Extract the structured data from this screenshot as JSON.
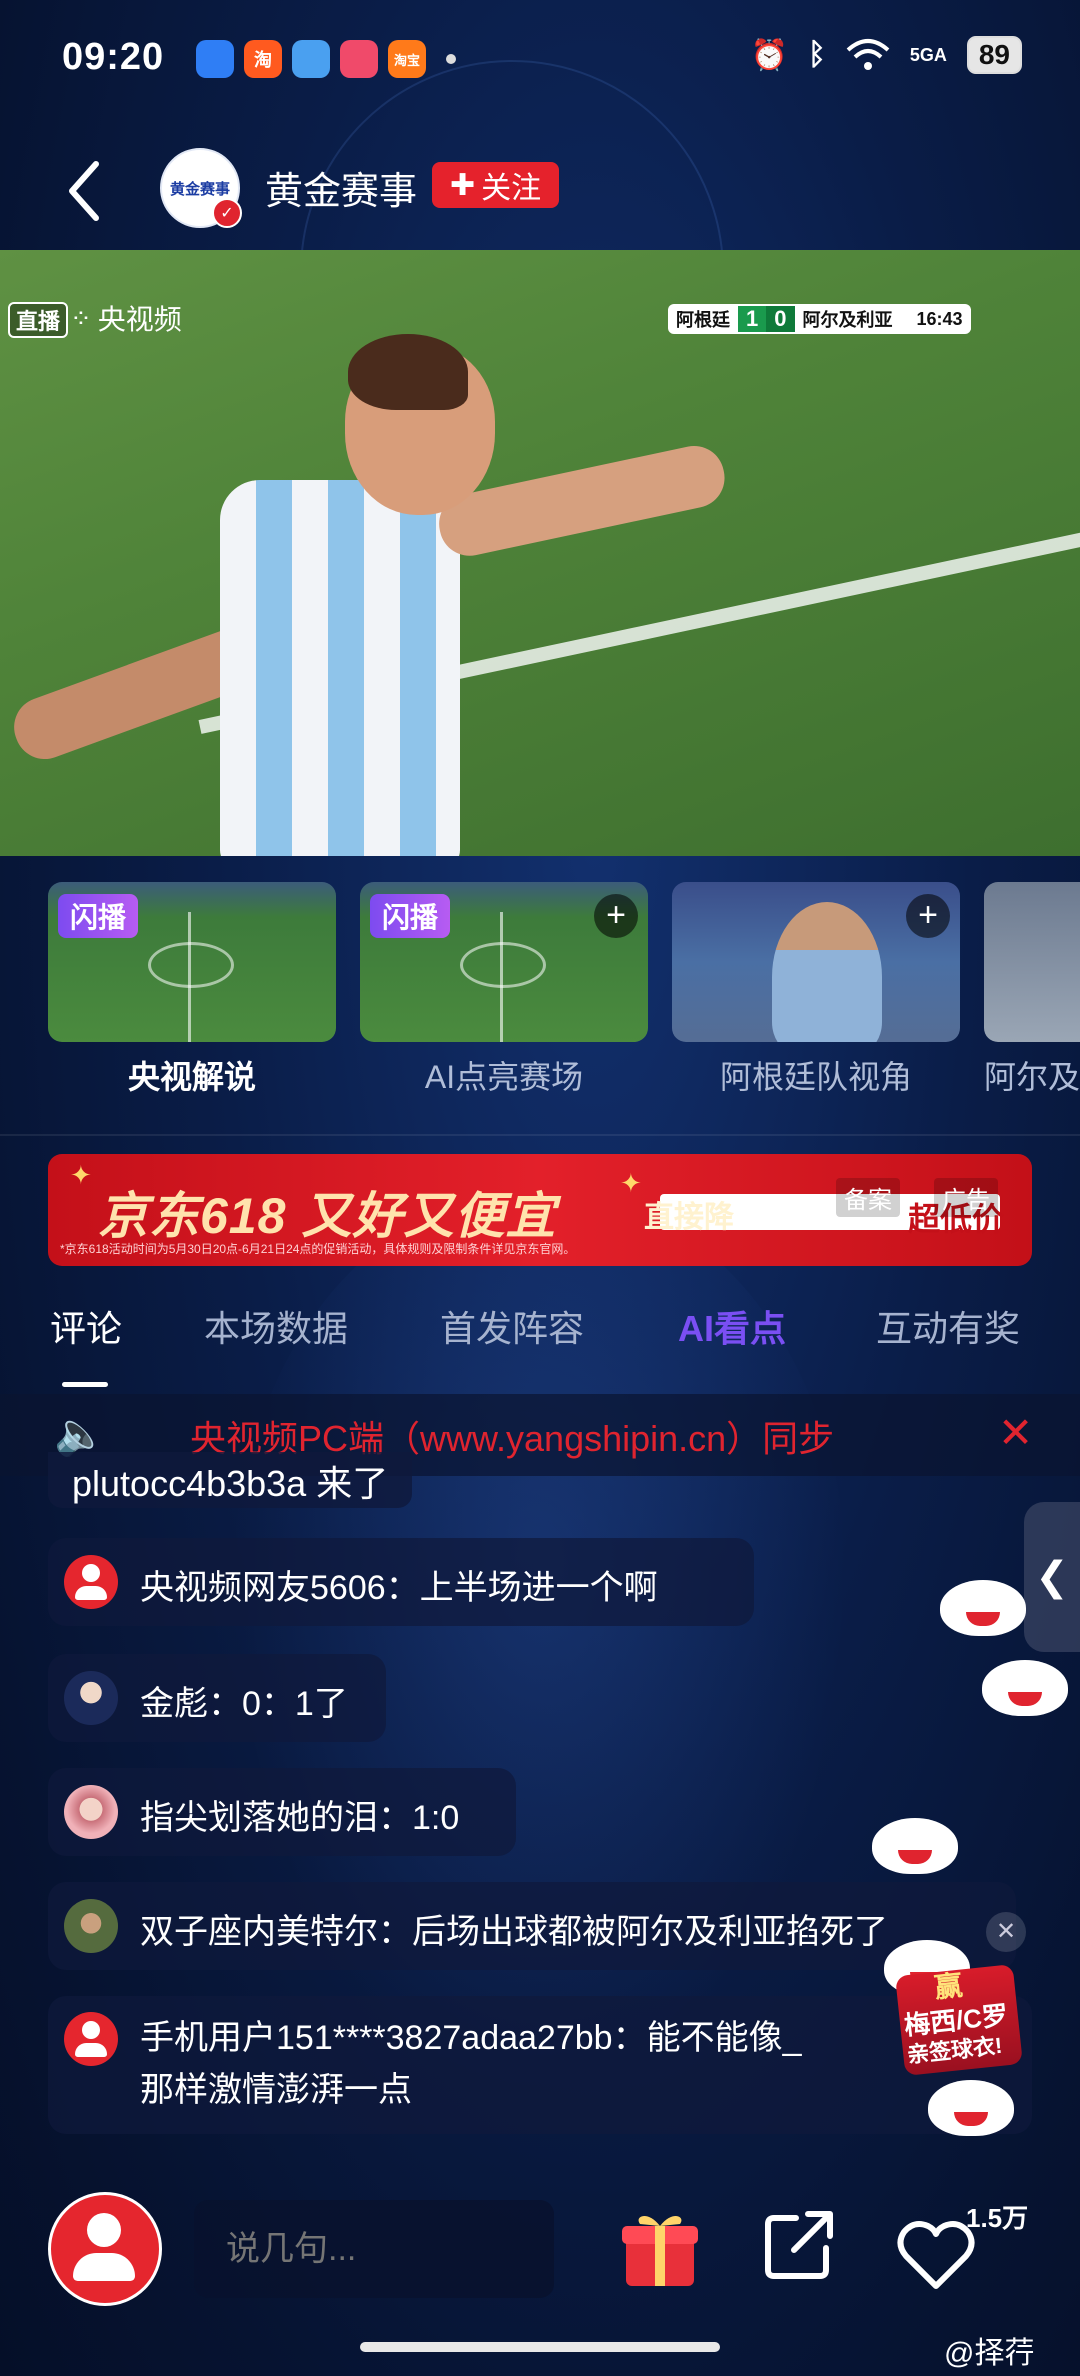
{
  "status_bar": {
    "time": "09:20",
    "network": "5GA",
    "battery": "89",
    "app_icons": [
      {
        "name": "app-icon-1",
        "label": "",
        "color": "#2f7ef5"
      },
      {
        "name": "taobao-icon",
        "label": "淘",
        "color": "#ff5a1f"
      },
      {
        "name": "app-icon-3",
        "label": "",
        "color": "#4aa0f0"
      },
      {
        "name": "app-icon-4",
        "label": "",
        "color": "#f04a6a"
      },
      {
        "name": "taobao-flash-icon",
        "label": "淘宝",
        "color": "#ff7a1a"
      }
    ]
  },
  "header": {
    "channel_name": "黄金赛事",
    "follow_label": "关注",
    "avatar_text": "黄金赛事"
  },
  "video": {
    "live_badge": "直播",
    "broadcaster": "央视频",
    "scoreboard": {
      "home": "阿根廷",
      "home_score": "1",
      "away_score": "0",
      "away": "阿尔及利亚",
      "clock": "16:43"
    }
  },
  "camera_views": [
    {
      "label": "央视解说",
      "tag": "闪播",
      "active": true
    },
    {
      "label": "AI点亮赛场",
      "tag": "闪播",
      "active": false
    },
    {
      "label": "阿根廷队视角",
      "tag": "",
      "active": false
    },
    {
      "label": "阿尔及",
      "tag": "",
      "active": false
    }
  ],
  "ad": {
    "title": "京东618 又好又便宜",
    "cta": "直接降",
    "cta_highlight": "超低价",
    "label_1": "备案",
    "label_2": "广告",
    "fine_print": "*京东618活动时间为5月30日20点-6月21日24点的促销活动，具体规则及限制条件详见京东官网。"
  },
  "tabs": [
    "评论",
    "本场数据",
    "首发阵容",
    "AI看点",
    "互动有奖"
  ],
  "notice": {
    "text": "央视频PC端（www.yangshipin.cn）同步"
  },
  "join_message": "plutocc4b3b3a 来了",
  "comments": [
    {
      "user": "央视频网友5606",
      "text": "上半场进一个啊"
    },
    {
      "user": "金彪",
      "text": "0：1了"
    },
    {
      "user": "指尖划落她的泪",
      "text": "1:0"
    },
    {
      "user": "双子座内美特尔",
      "text": "后场出球都被阿尔及利亚掐死了"
    },
    {
      "user": "手机用户151****3827adaa27bb",
      "text": "能不能像_",
      "text_line2": "那样激情澎湃一点"
    }
  ],
  "promo": {
    "line1": "赢",
    "line2": "梅西/C罗",
    "line3": "亲签球衣!"
  },
  "bottom_bar": {
    "input_placeholder": "说几句...",
    "like_count": "1.5万"
  },
  "watermark": "@择荇",
  "colors": {
    "accent_red": "#e5222c",
    "ai_purple": "#7a4ff3",
    "score_green": "#1a9a4d",
    "background": "#0a1d48"
  }
}
